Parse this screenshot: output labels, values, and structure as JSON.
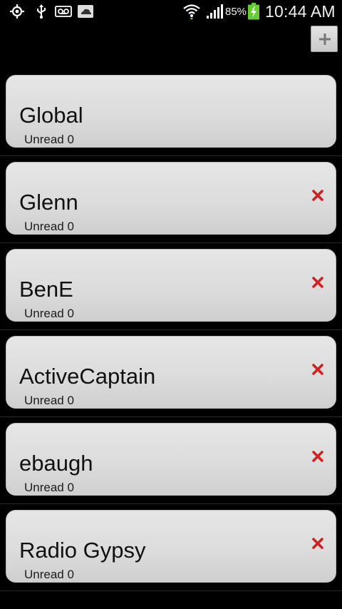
{
  "status_bar": {
    "icons": [
      "gps-icon",
      "usb-icon",
      "voicemail-icon",
      "cloud-sync-icon",
      "wifi-icon",
      "signal-icon",
      "battery-charging-icon"
    ],
    "battery_percent": "85%",
    "time": "10:44 AM"
  },
  "toolbar": {
    "add_icon": "plus-icon"
  },
  "channels": [
    {
      "name": "Global",
      "unread": "Unread 0",
      "deletable": false
    },
    {
      "name": "Glenn",
      "unread": "Unread 0",
      "deletable": true
    },
    {
      "name": "BenE",
      "unread": "Unread 0",
      "deletable": true
    },
    {
      "name": "ActiveCaptain",
      "unread": "Unread 0",
      "deletable": true
    },
    {
      "name": "ebaugh",
      "unread": "Unread 0",
      "deletable": true
    },
    {
      "name": "Radio Gypsy",
      "unread": "Unread 0",
      "deletable": true
    }
  ],
  "colors": {
    "background": "#000000",
    "card": "#dcdcdc",
    "delete": "#cc2222",
    "battery": "#66cc33"
  }
}
